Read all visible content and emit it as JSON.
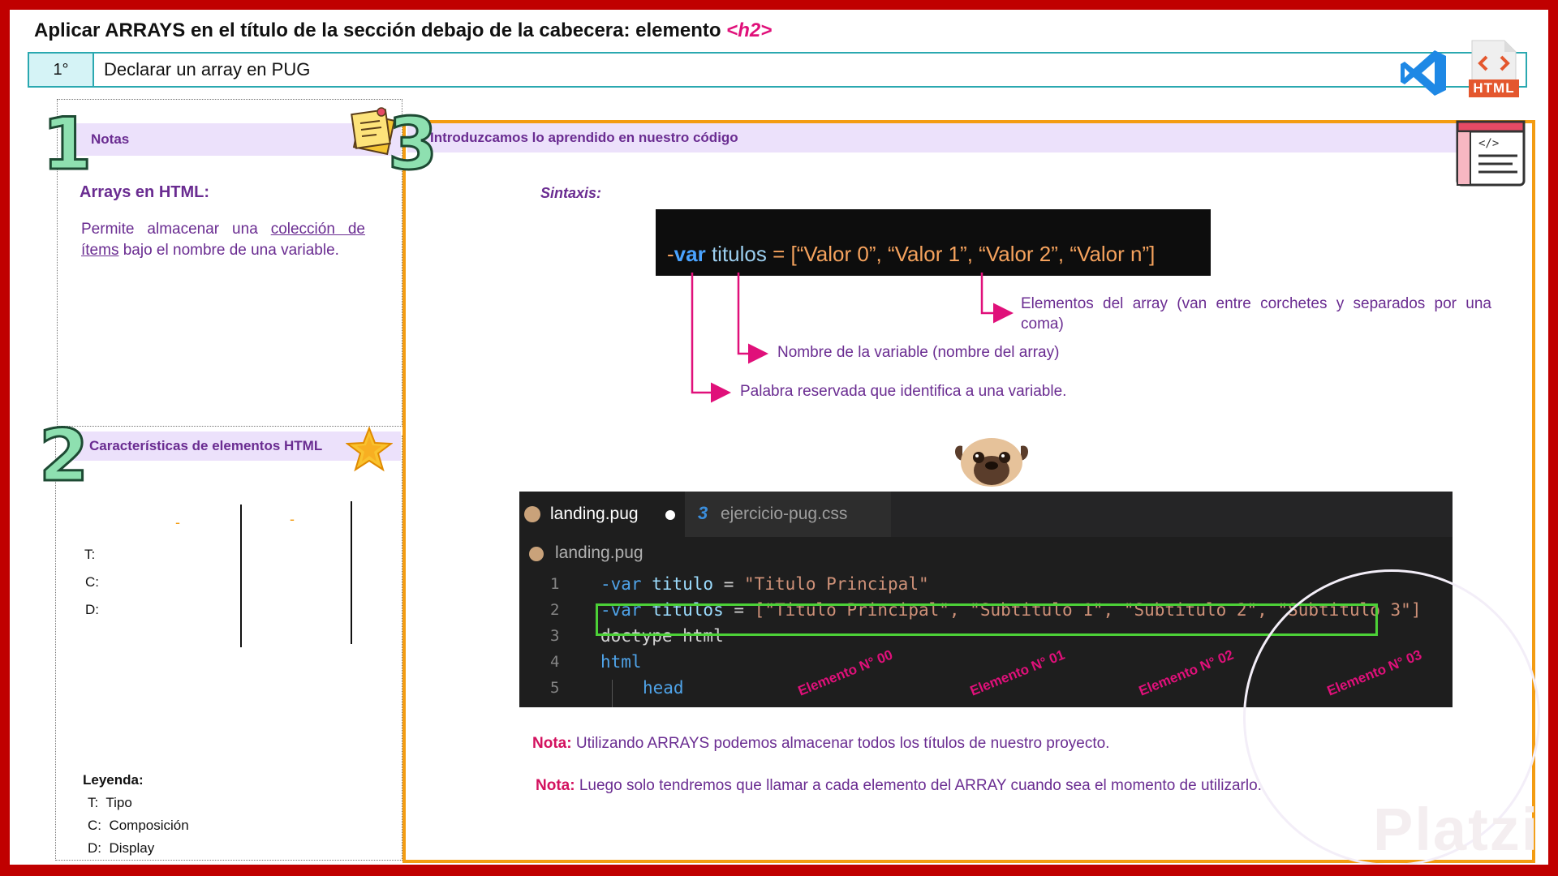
{
  "header": {
    "title_main": "Aplicar ARRAYS  en el título de la sección debajo de la cabecera: elemento ",
    "title_tag": "<h2>"
  },
  "step": {
    "number": "1°",
    "label": "Declarar un array en PUG"
  },
  "logos": {
    "html_badge": "HTML"
  },
  "notes": {
    "badge_number": "1",
    "heading": "Notas",
    "subtitle": "Arrays en HTML:",
    "text_before": "Permite almacenar una ",
    "text_link": "colección de ítems",
    "text_after": " bajo el nombre de una variable."
  },
  "characteristics": {
    "badge_number": "2",
    "heading": "Características de elementos HTML",
    "dash1": "-",
    "dash2": "-",
    "row_t": "T:",
    "row_c": "C:",
    "row_d": "D:",
    "legend_title": "Leyenda:",
    "legend_items": [
      {
        "key": "T:",
        "value": "Tipo"
      },
      {
        "key": "C:",
        "value": "Composición"
      },
      {
        "key": "D:",
        "value": "Display"
      }
    ]
  },
  "section3": {
    "badge_number": "3",
    "heading": "Introduzcamos lo aprendido en nuestro código",
    "syntax_label": "Sintaxis:",
    "syntax_code": {
      "dash": "-",
      "keyword": "var",
      "name": " titulos",
      "rest": " = [“Valor 0”, “Valor 1”, “Valor 2”, “Valor n”]"
    },
    "annotations": {
      "elements": "Elementos del array (van entre corchetes y separados por una coma)",
      "variable_name": "Nombre de la variable (nombre del array)",
      "reserved_word": "Palabra reservada que identifica a una variable."
    },
    "editor": {
      "tab_active": "landing.pug",
      "tab_inactive": "ejercicio-pug.css",
      "breadcrumb": "landing.pug",
      "lines": [
        {
          "num": "1",
          "a": "-var",
          "b": " titulo",
          "c": " = ",
          "d": "\"Titulo Principal\""
        },
        {
          "num": "2",
          "a": "-var",
          "b": " titulos",
          "c": " = ",
          "d": "[\"Titulo Principal\", \"Subtitulo 1\", \"Subtitulo 2\", \"Subtitulo 3\"]"
        },
        {
          "num": "3",
          "a": "doctype html"
        },
        {
          "num": "4",
          "a": "html"
        },
        {
          "num": "5",
          "a": "head"
        }
      ],
      "element_labels": [
        "Elemento N° 00",
        "Elemento N° 01",
        "Elemento N° 02",
        "Elemento N° 03"
      ]
    },
    "note1": {
      "label": "Nota:",
      "text": " Utilizando ARRAYS podemos almacenar todos los títulos de nuestro proyecto."
    },
    "note2": {
      "label": "Nota:",
      "text": " Luego solo tendremos que llamar a cada elemento del ARRAY cuando sea el momento de utilizarlo."
    }
  },
  "watermark": "Platzi",
  "colors": {
    "frame": "#c00000",
    "accent_teal": "#2aa8b0",
    "panel_orange": "#f39c12",
    "band_purple": "#ece1fb",
    "text_purple": "#6a2c91",
    "pink": "#e0107a",
    "highlight_green": "#4cd137"
  }
}
